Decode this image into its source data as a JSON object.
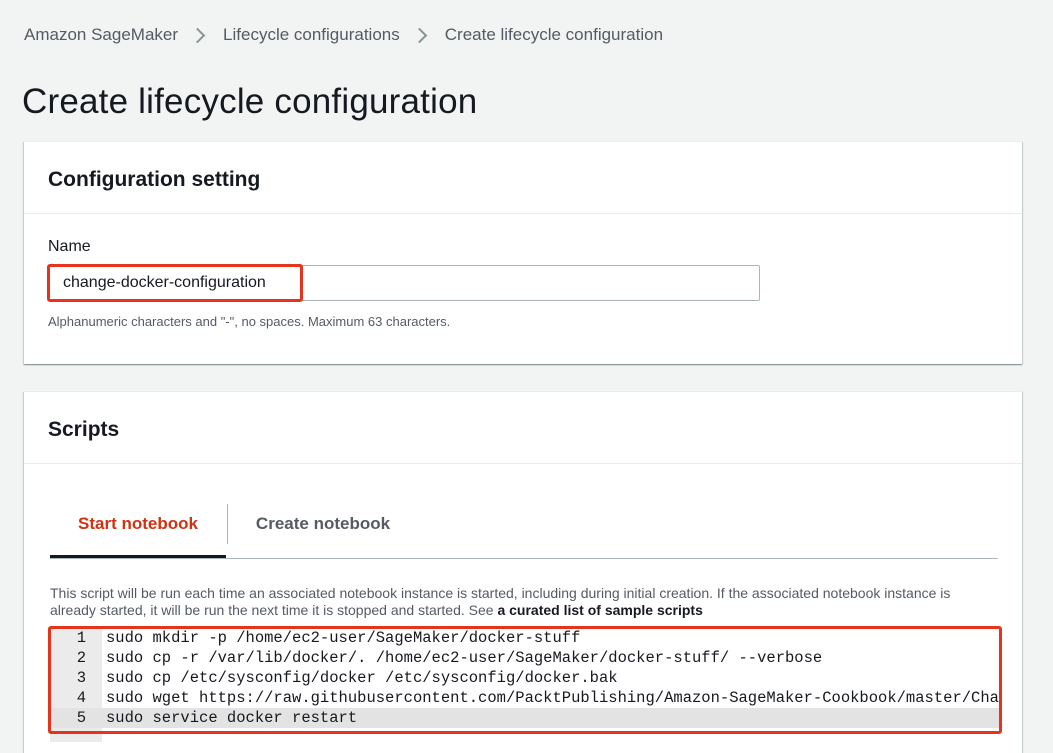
{
  "breadcrumb": {
    "items": [
      "Amazon SageMaker",
      "Lifecycle configurations",
      "Create lifecycle configuration"
    ]
  },
  "page_title": "Create lifecycle configuration",
  "config_panel": {
    "title": "Configuration setting",
    "name_label": "Name",
    "name_value": "change-docker-configuration",
    "name_hint": "Alphanumeric characters and \"-\", no spaces. Maximum 63 characters."
  },
  "scripts_panel": {
    "title": "Scripts",
    "tabs": [
      {
        "label": "Start notebook",
        "active": true
      },
      {
        "label": "Create notebook",
        "active": false
      }
    ],
    "description": "This script will be run each time an associated notebook instance is started, including during initial creation. If the associated notebook instance is already started, it will be run the next time it is stopped and started.  See ",
    "description_link": "a curated list of sample scripts",
    "lines": [
      {
        "num": "1",
        "code": "sudo mkdir -p /home/ec2-user/SageMaker/docker-stuff"
      },
      {
        "num": "2",
        "code": "sudo cp -r /var/lib/docker/. /home/ec2-user/SageMaker/docker-stuff/ --verbose"
      },
      {
        "num": "3",
        "code": "sudo cp /etc/sysconfig/docker /etc/sysconfig/docker.bak"
      },
      {
        "num": "4",
        "code": "sudo wget https://raw.githubusercontent.com/PacktPublishing/Amazon-SageMaker-Cookbook/master/Chapte"
      },
      {
        "num": "5",
        "code": "sudo service docker restart"
      }
    ]
  },
  "colors": {
    "highlight": "#e8331c",
    "active_tab": "#d13212",
    "background": "#f2f3f3"
  },
  "icons": [
    "chevron-right-icon"
  ]
}
